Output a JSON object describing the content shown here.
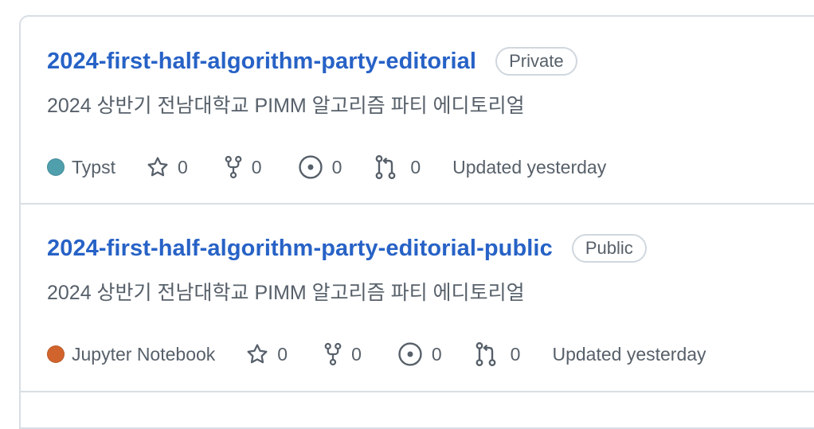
{
  "repos": [
    {
      "name": "2024-first-half-algorithm-party-editorial",
      "visibility": "Private",
      "description": "2024 상반기 전남대학교 PIMM 알고리즘 파티 에디토리얼",
      "language": "Typst",
      "language_color": "#4f9fad",
      "stars": "0",
      "forks": "0",
      "issues": "0",
      "pull_requests": "0",
      "updated": "Updated yesterday"
    },
    {
      "name": "2024-first-half-algorithm-party-editorial-public",
      "visibility": "Public",
      "description": "2024 상반기 전남대학교 PIMM 알고리즘 파티 에디토리얼",
      "language": "Jupyter Notebook",
      "language_color": "#d1642c",
      "stars": "0",
      "forks": "0",
      "issues": "0",
      "pull_requests": "0",
      "updated": "Updated yesterday"
    }
  ]
}
